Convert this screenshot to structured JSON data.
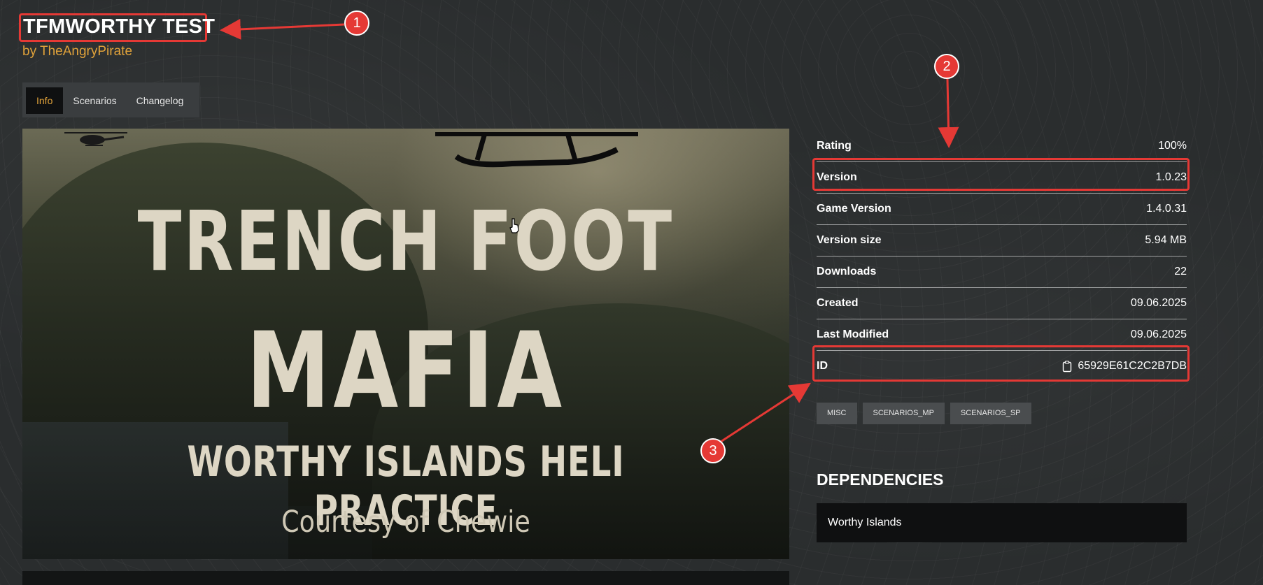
{
  "header": {
    "title": "TFMWORTHY TEST",
    "author": "by TheAngryPirate"
  },
  "tabs": [
    {
      "label": "Info",
      "active": true
    },
    {
      "label": "Scenarios",
      "active": false
    },
    {
      "label": "Changelog",
      "active": false
    }
  ],
  "hero": {
    "line1": "TRENCH FOOT",
    "line2": "MAFIA",
    "line3": "WORTHY ISLANDS HELI PRACTICE",
    "line4": "Courtesy of Chewie"
  },
  "details": [
    {
      "label": "Rating",
      "value": "100%"
    },
    {
      "label": "Version",
      "value": "1.0.23"
    },
    {
      "label": "Game Version",
      "value": "1.4.0.31"
    },
    {
      "label": "Version size",
      "value": "5.94 MB"
    },
    {
      "label": "Downloads",
      "value": "22"
    },
    {
      "label": "Created",
      "value": "09.06.2025"
    },
    {
      "label": "Last Modified",
      "value": "09.06.2025"
    },
    {
      "label": "ID",
      "value": "65929E61C2C2B7DB",
      "icon": "clipboard-icon"
    }
  ],
  "tags": [
    "MISC",
    "SCENARIOS_MP",
    "SCENARIOS_SP"
  ],
  "dependencies": {
    "title": "DEPENDENCIES",
    "items": [
      "Worthy Islands"
    ]
  },
  "annotations": {
    "badge1": "1",
    "badge2": "2",
    "badge3": "3",
    "color": "#e53935"
  },
  "colors": {
    "accent": "#e0a23a",
    "background": "#2a2d2e",
    "tab_bar": "#3a3d3f",
    "active_tab": "#0f1011",
    "tag_bg": "#4a4d4f"
  }
}
